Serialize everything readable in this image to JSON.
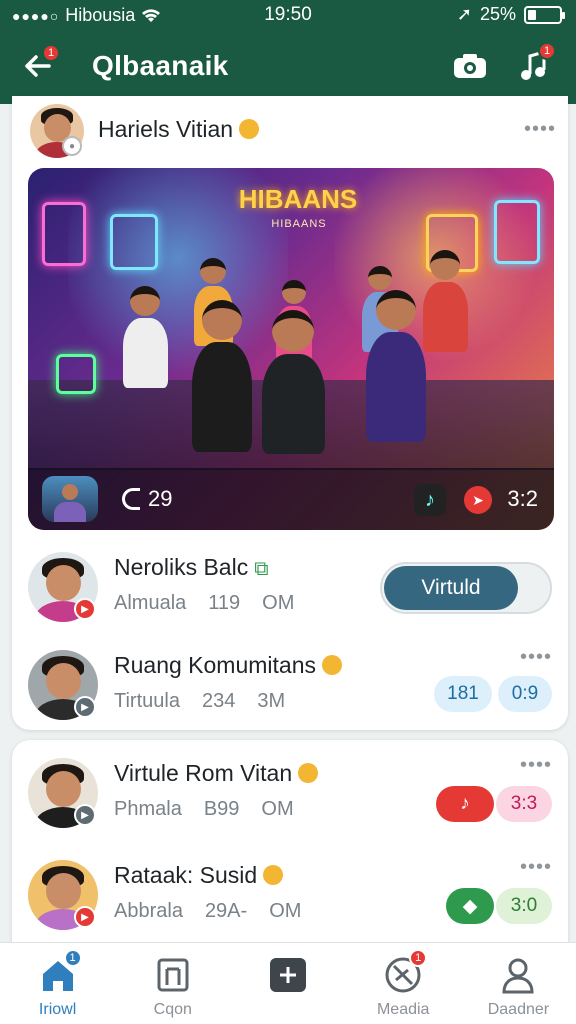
{
  "status_bar": {
    "carrier": "Hibousia",
    "time": "19:50",
    "battery": "25%",
    "battery_level": 0.25
  },
  "header": {
    "title": "Qlbaanaik",
    "back_badge": "1",
    "music_badge": "1"
  },
  "post": {
    "author": "Hariels Vitian",
    "more": "••••",
    "media": {
      "neon_title": "HIBAANS",
      "neon_subtitle": "HIBAANS",
      "likes": "29",
      "count": "3:2"
    }
  },
  "rows": [
    {
      "name": "Neroliks Balc",
      "meta_left": "Almuala",
      "meta_num": "119",
      "meta_unit": "OM",
      "toggle_label": "Virtuld"
    },
    {
      "name": "Ruang Komumitans",
      "meta_left": "Tirtuula",
      "meta_num": "234",
      "meta_unit": "3M",
      "more": "••••",
      "pill_a": "181",
      "pill_b": "0:9"
    },
    {
      "name": "Virtule Rom Vitan",
      "meta_left": "Phmala",
      "meta_num": "B99",
      "meta_unit": "OM",
      "more": "••••",
      "pill_a": "♪",
      "pill_b": "3:3"
    },
    {
      "name": "Rataak: Susid",
      "meta_left": "Abbrala",
      "meta_num": "29A-",
      "meta_unit": "OM",
      "more": "••••",
      "pill_a": "◆",
      "pill_b": "3:0"
    }
  ],
  "bottom_nav": [
    {
      "label": "Iriowl",
      "icon": "home-icon",
      "badge": "1"
    },
    {
      "label": "Cqon",
      "icon": "bookmark-icon"
    },
    {
      "label": "",
      "icon": "add-icon"
    },
    {
      "label": "Meadia",
      "icon": "media-icon",
      "badge": "1"
    },
    {
      "label": "Daadner",
      "icon": "profile-icon"
    }
  ],
  "colors": {
    "header_bg": "#1a5a43",
    "toggle": "#356880",
    "nav_active": "#2f7fbf"
  }
}
